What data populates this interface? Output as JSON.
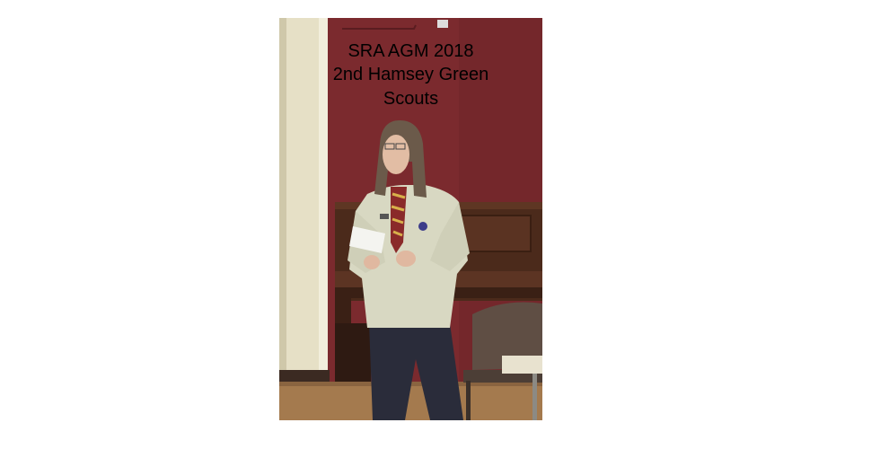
{
  "photo": {
    "caption": {
      "line1": "SRA AGM 2018",
      "line2": "2nd Hamsey Green",
      "line3": "Scouts"
    },
    "colors": {
      "page_background": "#ffffff",
      "wall_maroon": "#7b2a2e",
      "pillar_cream": "#e8e2c8",
      "piano_wood": "#4a2a1c",
      "shirt_beige": "#d9d9c4",
      "trousers_navy": "#2a2c3a",
      "floor_wood": "#a47a4e"
    }
  }
}
